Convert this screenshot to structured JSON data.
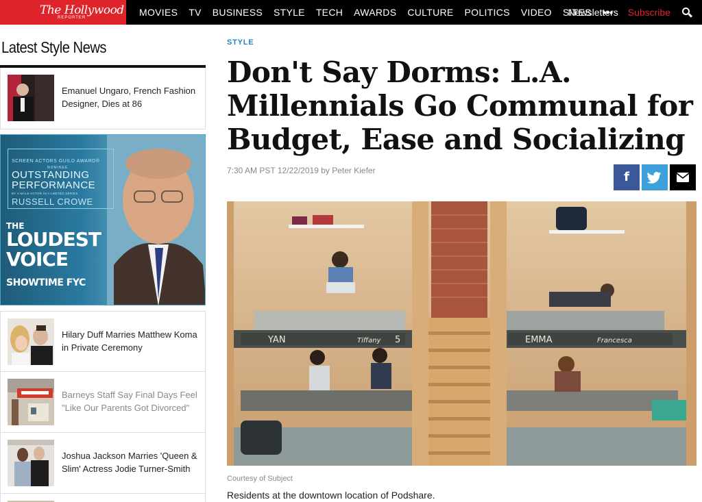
{
  "brand": {
    "logo_line1": "The Hollywood",
    "logo_line2": "REPORTER",
    "accent": "#e0242b"
  },
  "nav": {
    "items": [
      "MOVIES",
      "TV",
      "BUSINESS",
      "STYLE",
      "TECH",
      "AWARDS",
      "CULTURE",
      "POLITICS",
      "VIDEO",
      "SITES"
    ],
    "more": "•••",
    "newsletters": "Newsletters",
    "subscribe": "Subscribe",
    "search_icon": "search-icon"
  },
  "sidebar": {
    "title": "Latest Style News",
    "items": [
      {
        "text": "Emanuel Ungaro, French Fashion Designer, Dies at 86",
        "muted": false
      },
      {
        "text": "Hilary Duff Marries Matthew Koma in Private Ceremony",
        "muted": false
      },
      {
        "text": "Barneys Staff Say Final Days Feel \"Like Our Parents Got Divorced\"",
        "muted": true
      },
      {
        "text": "Joshua Jackson Marries 'Queen & Slim' Actress Jodie Turner-Smith",
        "muted": false
      }
    ],
    "ad": {
      "sag": "SCREEN ACTORS GUILD AWARD®",
      "nominee": "NOMINEE",
      "outstanding": "OUTSTANDING",
      "performance": "PERFORMANCE",
      "by": "BY A MALE ACTOR IN A LIMITED SERIES",
      "actor": "RUSSELL CROWE",
      "show_the": "THE",
      "show_l1": "LOUDEST",
      "show_l2": "VOICE",
      "network": "SHOWTIME FYC"
    }
  },
  "article": {
    "section": "STYLE",
    "headline": "Don't Say Dorms: L.A. Millennials Go Communal for Budget, Ease and Socializing",
    "byline": "7:30 AM PST 12/22/2019 by Peter Kiefer",
    "share": {
      "facebook": "f",
      "twitter": "🐦",
      "email": "✉"
    },
    "photo_labels": {
      "left": "YAN",
      "left2": "Tiffany",
      "left_num": "5",
      "right": "EMMA",
      "right2": "Francesca"
    },
    "credit": "Courtesy of Subject",
    "caption": "Residents at the downtown location of Podshare."
  }
}
